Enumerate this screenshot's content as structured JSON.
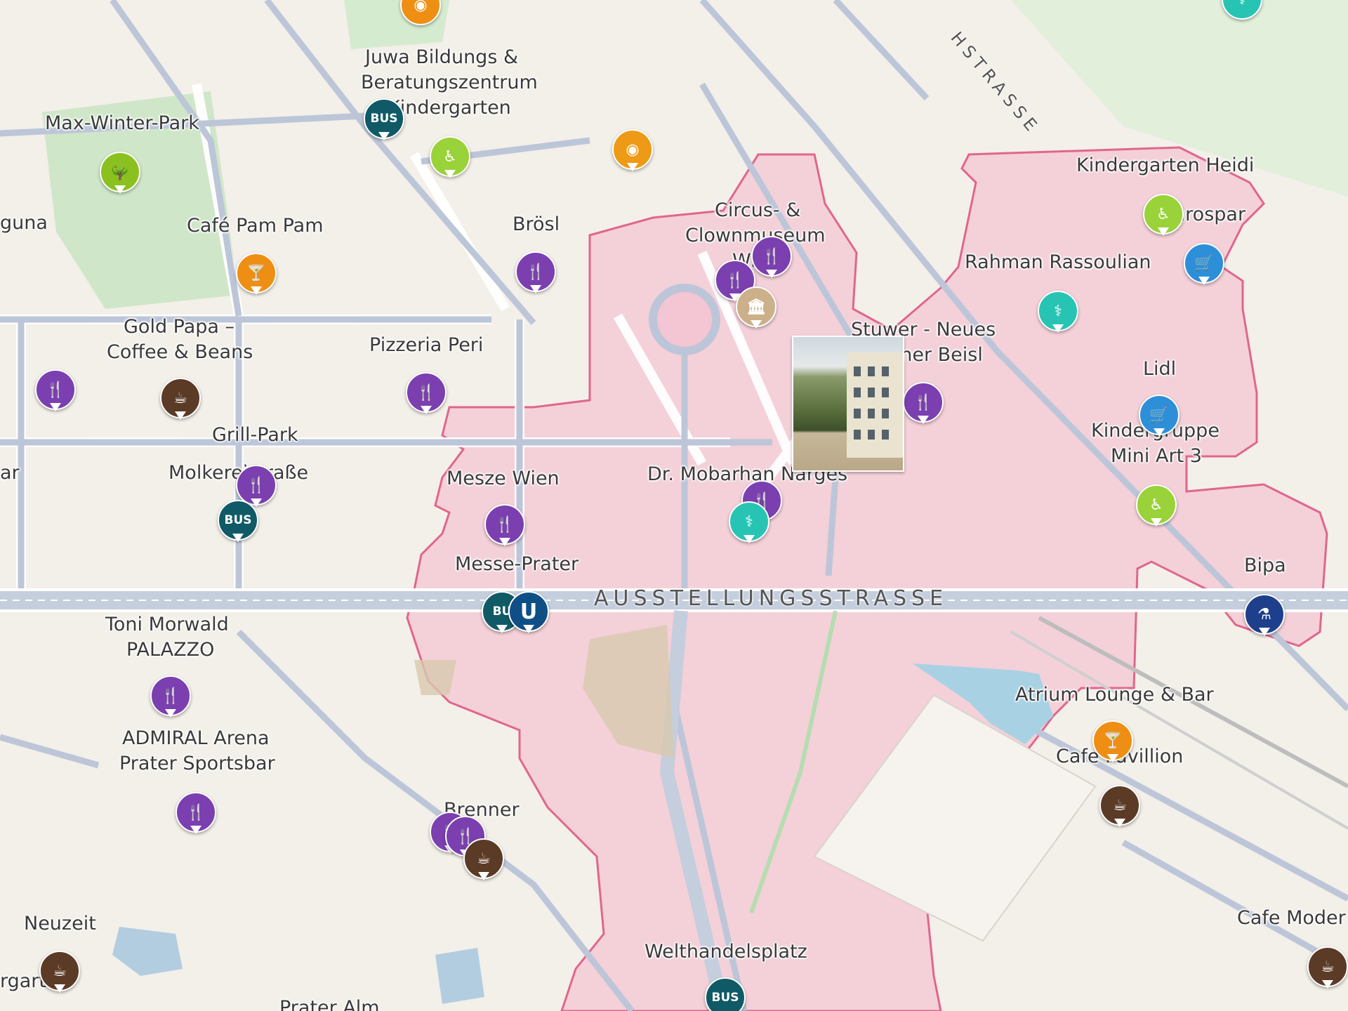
{
  "map": {
    "streets": [
      "AUSSTELLUNGSSTRASSE",
      "HSTRASSE"
    ],
    "labels": {
      "juwa": "Juwa Bildungs &",
      "juwa2": "Beratungszentrum",
      "kindergarten": "Kindergarten",
      "maxwinter": "Max-Winter-Park",
      "guna": "guna",
      "cafepampam": "Café Pam Pam",
      "broesl": "Brösl",
      "circus1": "Circus- &",
      "circus2": "Clownmuseum",
      "circus3": "Wien",
      "kgheidi": "Kindergarten Heidi",
      "eurospar": "Eurospar",
      "rahman": "Rahman Rassoulian",
      "goldpapa1": "Gold Papa –",
      "goldpapa2": "Coffee & Beans",
      "pizzeria": "Pizzeria Peri",
      "stuwer1": "Stuwer - Neues",
      "stuwer2": "Wiener Beisl",
      "lidl": "Lidl",
      "kgruppe1": "Kindergruppe",
      "kgruppe2": "Mini Art 3",
      "grillpark": "Grill-Park",
      "molkerei": "Molkereistraße",
      "ar": "ar",
      "mesze": "Mesze Wien",
      "mobarhan": "Dr. Mobarhan Narges",
      "messeprater": "Messe-Prater",
      "bipa": "Bipa",
      "toni1": "Toni Morwald",
      "toni2": "PALAZZO",
      "atrium": "Atrium Lounge & Bar",
      "admiral1": "ADMIRAL Arena",
      "admiral2": "Prater Sportsbar",
      "cafepavillion": "Cafe Pavillion",
      "brenner": "Brenner",
      "neuzeit": "Neuzeit",
      "cafemoder": "Cafe Moder",
      "rgarten": "rgarten",
      "welthandel": "Welthandelsplatz",
      "prateralm": "Prater Alm"
    },
    "badges": {
      "bus": "BUS",
      "ubahn": "U",
      "bu": "BU"
    },
    "colors": {
      "restaurant": "#7b3fb0",
      "cafe": "#5b3a26",
      "bar": "#ee8f14",
      "bus": "#0f5a66",
      "ubahn": "#0f4f86",
      "medical": "#27c4b4",
      "shop": "#2e8fd9",
      "kindergarten": "#9ad23a",
      "park": "#8ac11f",
      "museum": "#cbb08a",
      "pharmacy": "#1e3f8c",
      "area": "#f5b9cc"
    }
  }
}
